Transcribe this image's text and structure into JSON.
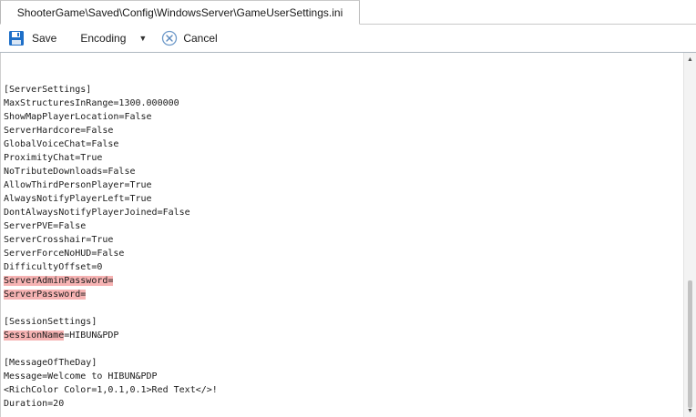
{
  "tab": {
    "title": "ShooterGame\\Saved\\Config\\WindowsServer\\GameUserSettings.ini"
  },
  "toolbar": {
    "save_label": "Save",
    "save_icon": "floppy-disk-icon",
    "encoding_label": "Encoding",
    "encoding_icon": "dropdown-caret-icon",
    "cancel_label": "Cancel",
    "cancel_icon": "cancel-circle-icon"
  },
  "colors": {
    "highlight": "#f6b3b3",
    "accent": "#1e6fc8"
  },
  "editor": {
    "lines": [
      {
        "text": ""
      },
      {
        "text": "[ServerSettings]"
      },
      {
        "text": "MaxStructuresInRange=1300.000000"
      },
      {
        "text": "ShowMapPlayerLocation=False"
      },
      {
        "text": "ServerHardcore=False"
      },
      {
        "text": "GlobalVoiceChat=False"
      },
      {
        "text": "ProximityChat=True"
      },
      {
        "text": "NoTributeDownloads=False"
      },
      {
        "text": "AllowThirdPersonPlayer=True"
      },
      {
        "text": "AlwaysNotifyPlayerLeft=True"
      },
      {
        "text": "DontAlwaysNotifyPlayerJoined=False"
      },
      {
        "text": "ServerPVE=False"
      },
      {
        "text": "ServerCrosshair=True"
      },
      {
        "text": "ServerForceNoHUD=False"
      },
      {
        "text": "DifficultyOffset=0"
      },
      {
        "highlight": "ServerAdminPassword=",
        "text": ""
      },
      {
        "highlight": "ServerPassword=",
        "text": ""
      },
      {
        "text": ""
      },
      {
        "text": "[SessionSettings]"
      },
      {
        "highlight": "SessionName",
        "text": "=HIBUN&PDP"
      },
      {
        "text": ""
      },
      {
        "text": "[MessageOfTheDay]"
      },
      {
        "text": "Message=Welcome to HIBUN&PDP"
      },
      {
        "text": "<RichColor Color=1,0.1,0.1>Red Text</>!"
      },
      {
        "text": "Duration=20"
      }
    ]
  }
}
